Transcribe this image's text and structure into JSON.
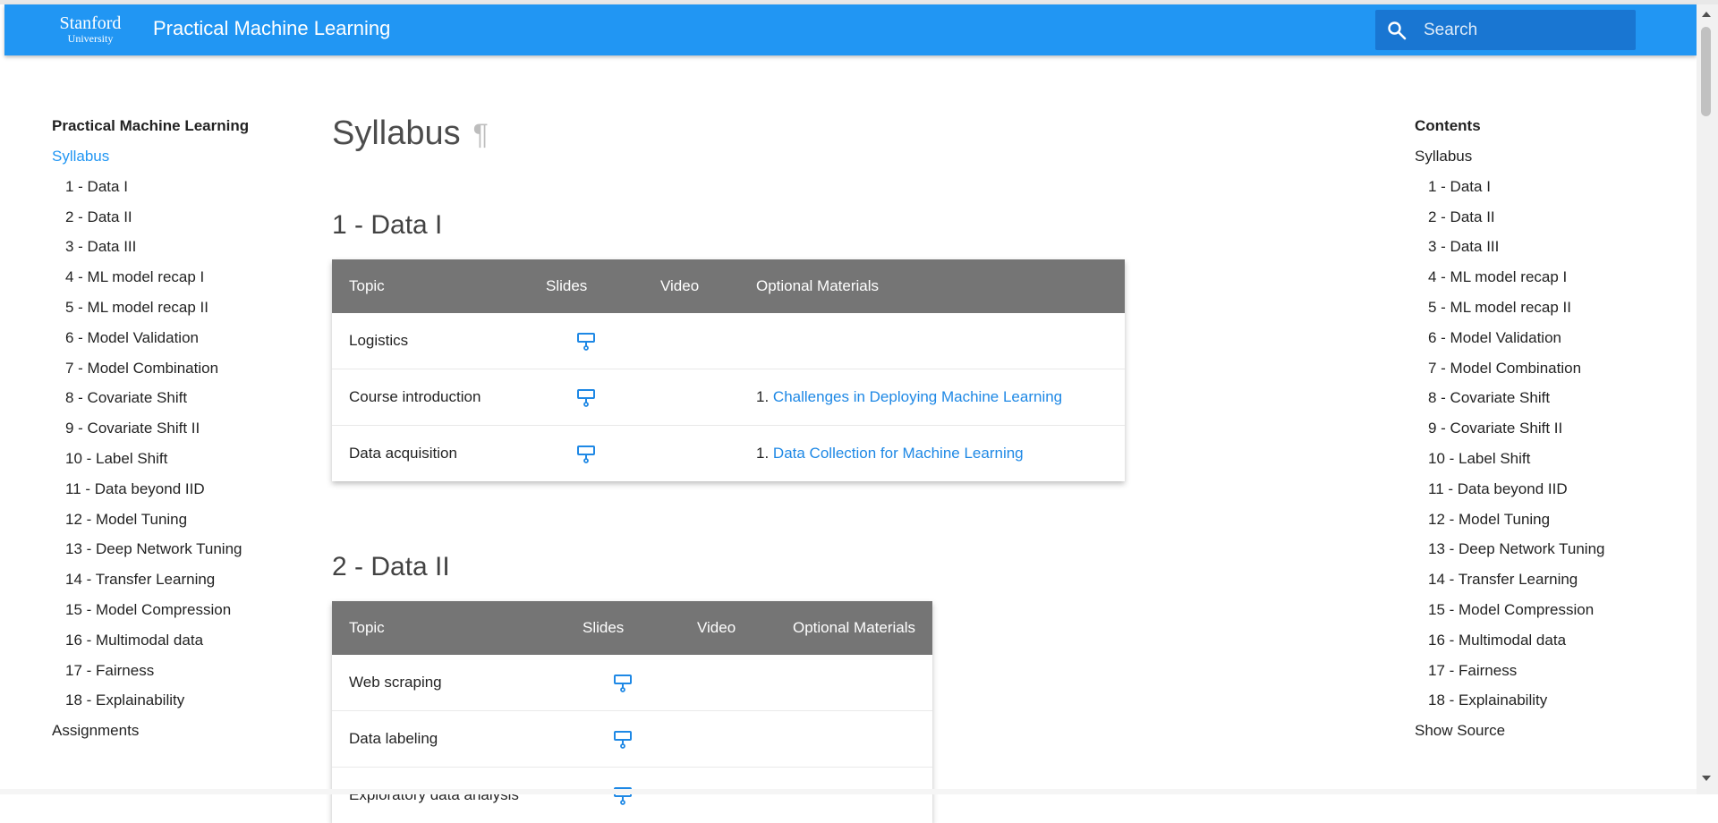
{
  "header": {
    "logo_name": "Stanford",
    "logo_sub": "University",
    "site_title": "Practical Machine Learning",
    "search_placeholder": "Search"
  },
  "nav": {
    "title": "Practical Machine Learning",
    "syllabus": "Syllabus",
    "items": [
      "1 - Data I",
      "2 - Data II",
      "3 - Data III",
      "4 - ML model recap I",
      "5 - ML model recap II",
      "6 - Model Validation",
      "7 - Model Combination",
      "8 - Covariate Shift",
      "9 - Covariate Shift II",
      "10 - Label Shift",
      "11 - Data beyond IID",
      "12 - Model Tuning",
      "13 - Deep Network Tuning",
      "14 - Transfer Learning",
      "15 - Model Compression",
      "16 - Multimodal data",
      "17 - Fairness",
      "18 - Explainability"
    ],
    "assignments": "Assignments"
  },
  "toc": {
    "title": "Contents",
    "syllabus": "Syllabus",
    "items": [
      "1 - Data I",
      "2 - Data II",
      "3 - Data III",
      "4 - ML model recap I",
      "5 - ML model recap II",
      "6 - Model Validation",
      "7 - Model Combination",
      "8 - Covariate Shift",
      "9 - Covariate Shift II",
      "10 - Label Shift",
      "11 - Data beyond IID",
      "12 - Model Tuning",
      "13 - Deep Network Tuning",
      "14 - Transfer Learning",
      "15 - Model Compression",
      "16 - Multimodal data",
      "17 - Fairness",
      "18 - Explainability"
    ],
    "show_source": "Show Source"
  },
  "main": {
    "page_title": "Syllabus",
    "pilcrow": "¶",
    "columns": [
      "Topic",
      "Slides",
      "Video",
      "Optional Materials"
    ],
    "sections": [
      {
        "title": "1 - Data I",
        "rows": [
          {
            "topic": "Logistics",
            "slides": true,
            "num": "",
            "material": ""
          },
          {
            "topic": "Course introduction",
            "slides": true,
            "num": "1.",
            "material": "Challenges in Deploying Machine Learning"
          },
          {
            "topic": "Data acquisition",
            "slides": true,
            "num": "1.",
            "material": "Data Collection for Machine Learning"
          }
        ]
      },
      {
        "title": "2 - Data II",
        "rows": [
          {
            "topic": "Web scraping",
            "slides": true,
            "num": "",
            "material": ""
          },
          {
            "topic": "Data labeling",
            "slides": true,
            "num": "",
            "material": ""
          },
          {
            "topic": "Exploratory data analysis",
            "slides": true,
            "num": "",
            "material": ""
          }
        ]
      }
    ]
  },
  "colors": {
    "header": "#2196f3",
    "search_bg": "#1976d2",
    "table_header": "#757575",
    "link": "#1e88e5"
  },
  "icons": {
    "search": "search-icon",
    "slides": "presentation-icon"
  }
}
